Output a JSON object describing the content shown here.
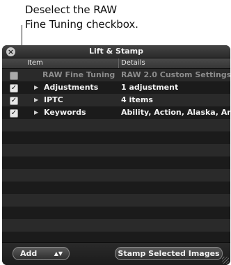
{
  "callout": {
    "text": "Deselect the RAW\nFine Tuning checkbox."
  },
  "window": {
    "title": "Lift & Stamp",
    "close_icon": "close-icon"
  },
  "table": {
    "headers": {
      "item": "Item",
      "details": "Details"
    },
    "rows": [
      {
        "checked": false,
        "expandable": false,
        "item": "RAW Fine Tuning",
        "details": "RAW 2.0 Custom Settings"
      },
      {
        "checked": true,
        "expandable": true,
        "item": "Adjustments",
        "details": "1 adjustment"
      },
      {
        "checked": true,
        "expandable": true,
        "item": "IPTC",
        "details": "4 items"
      },
      {
        "checked": true,
        "expandable": true,
        "item": "Keywords",
        "details": "Ability, Action, Alaska, Am"
      }
    ],
    "empty_row_count": 12
  },
  "footer": {
    "add_label": "Add",
    "stamp_label": "Stamp Selected Images"
  },
  "colors": {
    "panel_bg": "#161616",
    "row_even": "#2a2a2a",
    "row_odd": "#1b1b1b",
    "text_dim": "#8c8c8c"
  }
}
